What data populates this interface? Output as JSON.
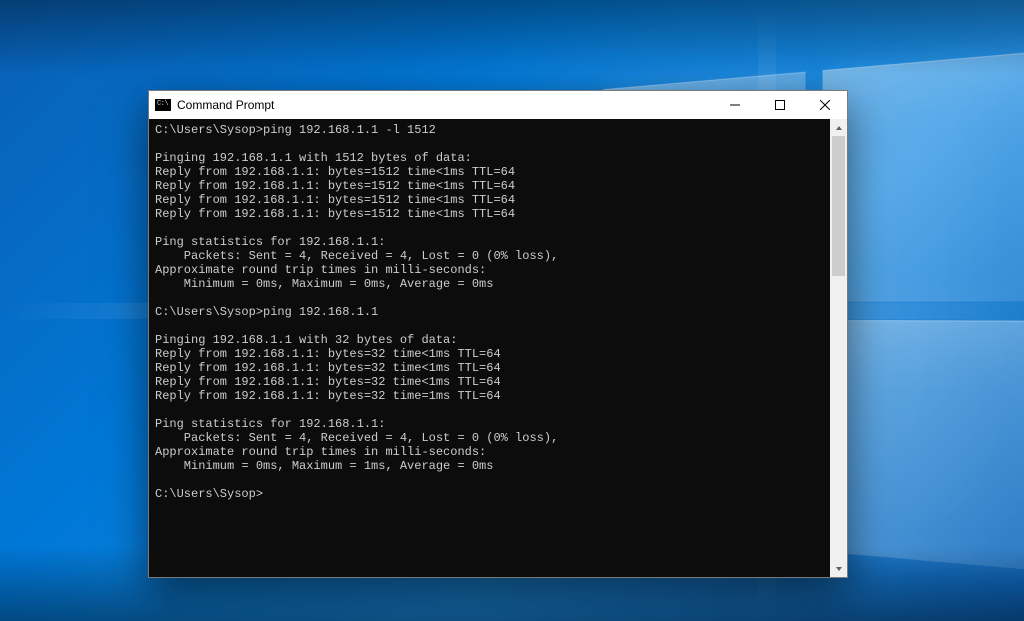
{
  "window": {
    "title": "Command Prompt"
  },
  "terminal": {
    "lines": [
      "C:\\Users\\Sysop>ping 192.168.1.1 -l 1512",
      "",
      "Pinging 192.168.1.1 with 1512 bytes of data:",
      "Reply from 192.168.1.1: bytes=1512 time<1ms TTL=64",
      "Reply from 192.168.1.1: bytes=1512 time<1ms TTL=64",
      "Reply from 192.168.1.1: bytes=1512 time<1ms TTL=64",
      "Reply from 192.168.1.1: bytes=1512 time<1ms TTL=64",
      "",
      "Ping statistics for 192.168.1.1:",
      "    Packets: Sent = 4, Received = 4, Lost = 0 (0% loss),",
      "Approximate round trip times in milli-seconds:",
      "    Minimum = 0ms, Maximum = 0ms, Average = 0ms",
      "",
      "C:\\Users\\Sysop>ping 192.168.1.1",
      "",
      "Pinging 192.168.1.1 with 32 bytes of data:",
      "Reply from 192.168.1.1: bytes=32 time<1ms TTL=64",
      "Reply from 192.168.1.1: bytes=32 time<1ms TTL=64",
      "Reply from 192.168.1.1: bytes=32 time<1ms TTL=64",
      "Reply from 192.168.1.1: bytes=32 time=1ms TTL=64",
      "",
      "Ping statistics for 192.168.1.1:",
      "    Packets: Sent = 4, Received = 4, Lost = 0 (0% loss),",
      "Approximate round trip times in milli-seconds:",
      "    Minimum = 0ms, Maximum = 1ms, Average = 0ms",
      "",
      "C:\\Users\\Sysop>"
    ]
  }
}
